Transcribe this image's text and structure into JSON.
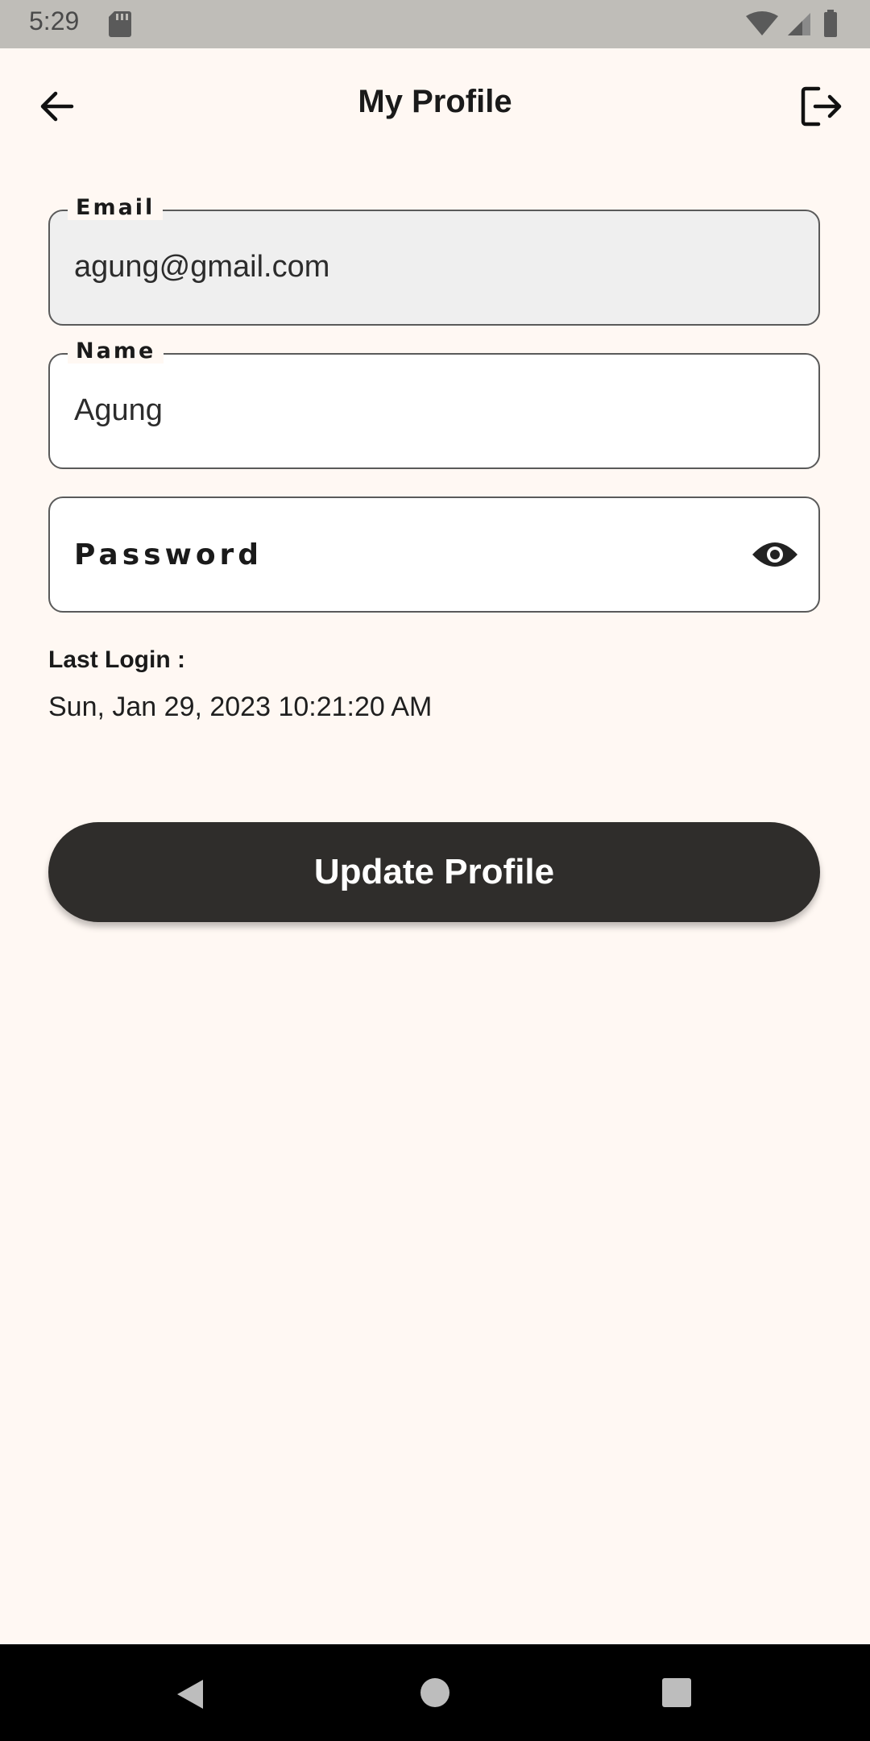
{
  "status_bar": {
    "time": "5:29"
  },
  "header": {
    "title": "My Profile"
  },
  "form": {
    "email": {
      "label": "Email",
      "value": "agung@gmail.com"
    },
    "name": {
      "label": "Name",
      "value": "Agung"
    },
    "password": {
      "placeholder": "Password"
    }
  },
  "last_login": {
    "label": "Last Login :",
    "value": "Sun, Jan 29, 2023 10:21:20 AM"
  },
  "actions": {
    "update_label": "Update Profile"
  },
  "icons": {
    "back": "arrow-left-icon",
    "logout": "logout-icon",
    "visibility": "eye-icon"
  },
  "colors": {
    "background": "#fff8f3",
    "button": "#2f2d2b",
    "disabled_field": "#efefef"
  }
}
